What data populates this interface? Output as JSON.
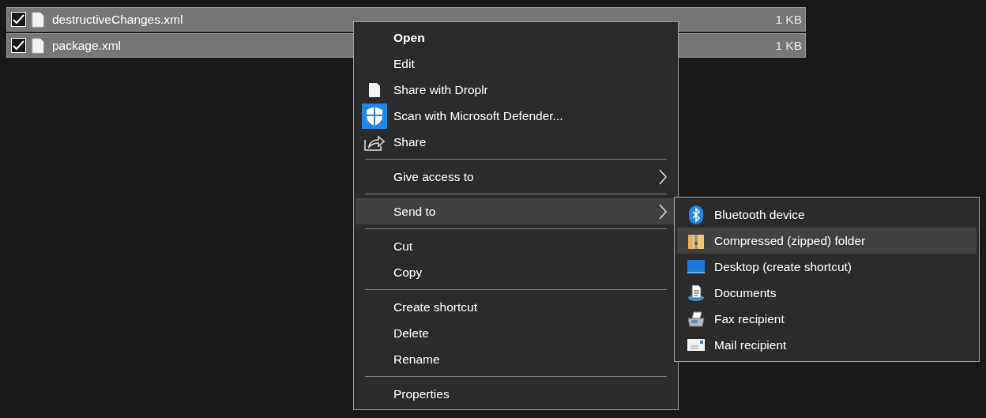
{
  "files": [
    {
      "name": "destructiveChanges.xml",
      "size": "1 KB",
      "checked": true,
      "selected": true
    },
    {
      "name": "package.xml",
      "size": "1 KB",
      "checked": true,
      "selected": true
    }
  ],
  "context_menu": {
    "items": [
      {
        "kind": "item",
        "label": "Open",
        "default": true,
        "selected": false
      },
      {
        "kind": "item",
        "label": "Edit",
        "selected": false
      },
      {
        "kind": "item",
        "label": "Share with Droplr",
        "selected": false
      },
      {
        "kind": "item",
        "label": "Scan with Microsoft Defender...",
        "selected": false
      },
      {
        "kind": "item",
        "label": "Share",
        "selected": false
      },
      {
        "kind": "separator"
      },
      {
        "kind": "item",
        "label": "Give access to",
        "has_submenu": true,
        "selected": false
      },
      {
        "kind": "separator"
      },
      {
        "kind": "item",
        "label": "Send to",
        "has_submenu": true,
        "selected": true
      },
      {
        "kind": "separator"
      },
      {
        "kind": "item",
        "label": "Cut",
        "selected": false
      },
      {
        "kind": "item",
        "label": "Copy",
        "selected": false
      },
      {
        "kind": "separator"
      },
      {
        "kind": "item",
        "label": "Create shortcut",
        "selected": false
      },
      {
        "kind": "item",
        "label": "Delete",
        "selected": false
      },
      {
        "kind": "item",
        "label": "Rename",
        "selected": false
      },
      {
        "kind": "separator"
      },
      {
        "kind": "item",
        "label": "Properties",
        "selected": false
      }
    ]
  },
  "send_to_menu": {
    "items": [
      {
        "label": "Bluetooth device",
        "selected": false
      },
      {
        "label": "Compressed (zipped) folder",
        "selected": true
      },
      {
        "label": "Desktop (create shortcut)",
        "selected": false
      },
      {
        "label": "Documents",
        "selected": false
      },
      {
        "label": "Fax recipient",
        "selected": false
      },
      {
        "label": "Mail recipient",
        "selected": false
      }
    ]
  }
}
